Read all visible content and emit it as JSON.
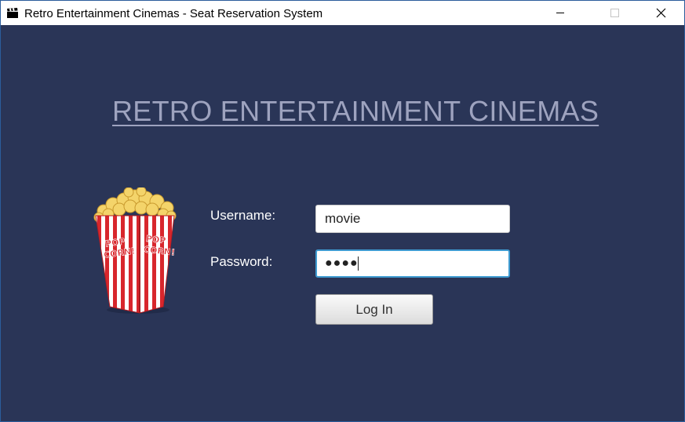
{
  "window": {
    "title": "Retro Entertainment Cinemas - Seat Reservation System",
    "icon": "clapperboard-icon",
    "controls": [
      "minimize-icon",
      "maximize-icon",
      "close-icon"
    ]
  },
  "heading": "RETRO ENTERTAINMENT CINEMAS",
  "illustration": {
    "icon": "popcorn-icon",
    "lettering": "POP CORN!"
  },
  "form": {
    "username_label": "Username:",
    "username_value": "movie",
    "password_label": "Password:",
    "password_masked": "●●●●",
    "login_label": "Log In"
  },
  "colors": {
    "background": "#2a3557",
    "heading": "#9ea3bf",
    "label": "#ffffff",
    "focus_border": "#3f9bd1"
  }
}
